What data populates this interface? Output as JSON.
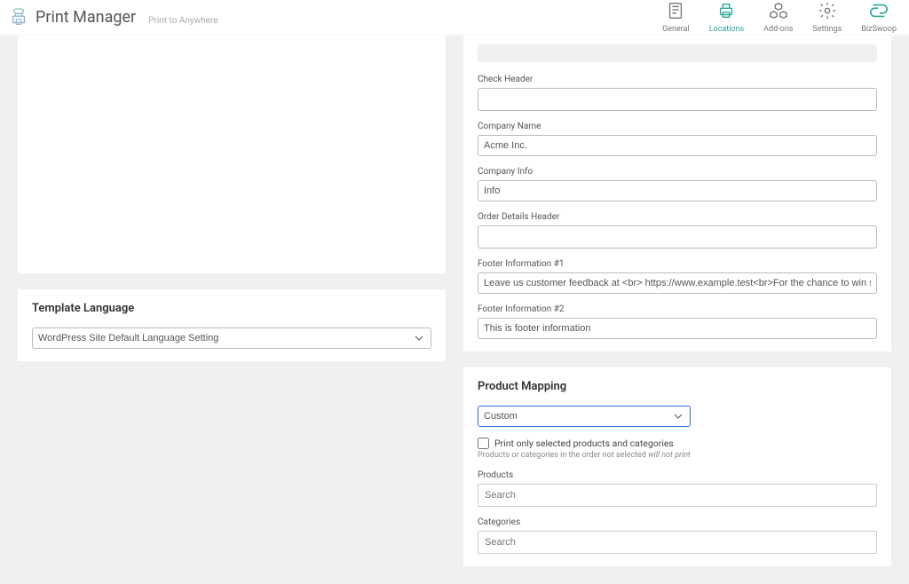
{
  "header": {
    "brand_title": "Print Manager",
    "brand_sub": "Print to Anywhere",
    "nav": {
      "general": "General",
      "locations": "Locations",
      "addons": "Add-ons",
      "settings": "Settings",
      "bizswoop": "BizSwoop"
    }
  },
  "form": {
    "check_header_label": "Check Header",
    "check_header_value": "",
    "company_name_label": "Company Name",
    "company_name_value": "Acme Inc.",
    "company_info_label": "Company Info",
    "company_info_value": "Info",
    "order_details_header_label": "Order Details Header",
    "order_details_header_value": "",
    "footer1_label": "Footer Information #1",
    "footer1_value": "Leave us customer feedback at <br> https://www.example.test<br>For the chance to win something free",
    "footer2_label": "Footer Information #2",
    "footer2_value": "This is footer information"
  },
  "template_language": {
    "title": "Template Language",
    "selected": "WordPress Site Default Language Setting"
  },
  "product_mapping": {
    "title": "Product Mapping",
    "selected": "Custom",
    "checkbox_label": "Print only selected products and categories",
    "hint_prefix": "Products or categories in the order not selected ",
    "hint_italic": "will not print",
    "products_label": "Products",
    "products_placeholder": "Search",
    "categories_label": "Categories",
    "categories_placeholder": "Search"
  }
}
